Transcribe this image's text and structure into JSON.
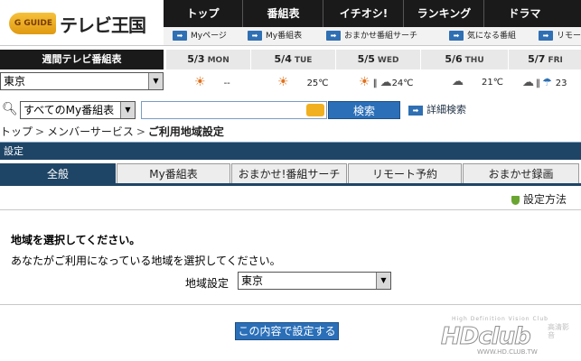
{
  "logo": {
    "badge": "G GUIDE",
    "title": "テレビ王国"
  },
  "top_nav": [
    "トップ",
    "番組表",
    "イチオシ!",
    "ランキング",
    "ドラマ"
  ],
  "sub_nav": [
    "Myページ",
    "My番組表",
    "おまかせ番組サーチ",
    "気になる番組",
    "リモー"
  ],
  "weekly": {
    "label": "週間テレビ番組表",
    "region": "東京",
    "days": [
      {
        "date": "5/3",
        "weekday": "MON",
        "temp": "--"
      },
      {
        "date": "5/4",
        "weekday": "TUE",
        "temp": "25℃"
      },
      {
        "date": "5/5",
        "weekday": "WED",
        "temp": "24℃"
      },
      {
        "date": "5/6",
        "weekday": "THU",
        "temp": "21℃"
      },
      {
        "date": "5/7",
        "weekday": "FRI",
        "temp": "23"
      }
    ]
  },
  "search": {
    "scope": "すべてのMy番組表",
    "button": "検索",
    "advanced": "詳細検索"
  },
  "breadcrumb": [
    "トップ",
    "メンバーサービス",
    "ご利用地域設定"
  ],
  "section_title": "設定",
  "tabs": [
    "全般",
    "My番組表",
    "おまかせ!番組サーチ",
    "リモート予約",
    "おまかせ録画"
  ],
  "content": {
    "guide_link": "設定方法",
    "title": "地域を選択してください。",
    "body": "あなたがご利用になっている地域を選択してください。",
    "area_label": "地域設定",
    "area_value": "東京",
    "submit": "この内容で設定する"
  },
  "watermark": {
    "tagline": "High Definition Vision Club",
    "logo": "HDclub",
    "url": "WWW.HD.CLUB.TW",
    "cjk": "高清影音"
  },
  "colors": {
    "dark_bar": "#1a1a1a",
    "navy": "#1f4566",
    "blue_button": "#2a6fb8"
  }
}
